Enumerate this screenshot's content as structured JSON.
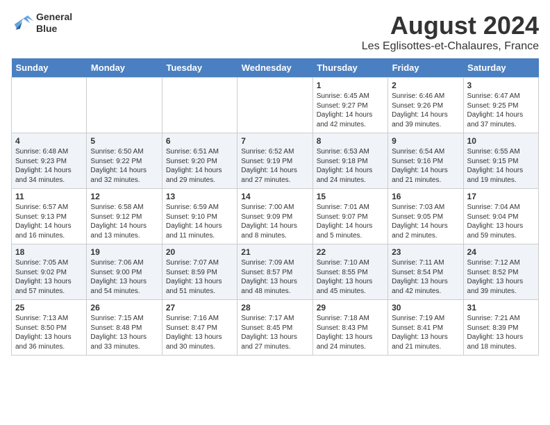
{
  "logo": {
    "line1": "General",
    "line2": "Blue"
  },
  "title": "August 2024",
  "location": "Les Eglisottes-et-Chalaures, France",
  "days_of_week": [
    "Sunday",
    "Monday",
    "Tuesday",
    "Wednesday",
    "Thursday",
    "Friday",
    "Saturday"
  ],
  "weeks": [
    [
      {
        "day": "",
        "content": ""
      },
      {
        "day": "",
        "content": ""
      },
      {
        "day": "",
        "content": ""
      },
      {
        "day": "",
        "content": ""
      },
      {
        "day": "1",
        "content": "Sunrise: 6:45 AM\nSunset: 9:27 PM\nDaylight: 14 hours\nand 42 minutes."
      },
      {
        "day": "2",
        "content": "Sunrise: 6:46 AM\nSunset: 9:26 PM\nDaylight: 14 hours\nand 39 minutes."
      },
      {
        "day": "3",
        "content": "Sunrise: 6:47 AM\nSunset: 9:25 PM\nDaylight: 14 hours\nand 37 minutes."
      }
    ],
    [
      {
        "day": "4",
        "content": "Sunrise: 6:48 AM\nSunset: 9:23 PM\nDaylight: 14 hours\nand 34 minutes."
      },
      {
        "day": "5",
        "content": "Sunrise: 6:50 AM\nSunset: 9:22 PM\nDaylight: 14 hours\nand 32 minutes."
      },
      {
        "day": "6",
        "content": "Sunrise: 6:51 AM\nSunset: 9:20 PM\nDaylight: 14 hours\nand 29 minutes."
      },
      {
        "day": "7",
        "content": "Sunrise: 6:52 AM\nSunset: 9:19 PM\nDaylight: 14 hours\nand 27 minutes."
      },
      {
        "day": "8",
        "content": "Sunrise: 6:53 AM\nSunset: 9:18 PM\nDaylight: 14 hours\nand 24 minutes."
      },
      {
        "day": "9",
        "content": "Sunrise: 6:54 AM\nSunset: 9:16 PM\nDaylight: 14 hours\nand 21 minutes."
      },
      {
        "day": "10",
        "content": "Sunrise: 6:55 AM\nSunset: 9:15 PM\nDaylight: 14 hours\nand 19 minutes."
      }
    ],
    [
      {
        "day": "11",
        "content": "Sunrise: 6:57 AM\nSunset: 9:13 PM\nDaylight: 14 hours\nand 16 minutes."
      },
      {
        "day": "12",
        "content": "Sunrise: 6:58 AM\nSunset: 9:12 PM\nDaylight: 14 hours\nand 13 minutes."
      },
      {
        "day": "13",
        "content": "Sunrise: 6:59 AM\nSunset: 9:10 PM\nDaylight: 14 hours\nand 11 minutes."
      },
      {
        "day": "14",
        "content": "Sunrise: 7:00 AM\nSunset: 9:09 PM\nDaylight: 14 hours\nand 8 minutes."
      },
      {
        "day": "15",
        "content": "Sunrise: 7:01 AM\nSunset: 9:07 PM\nDaylight: 14 hours\nand 5 minutes."
      },
      {
        "day": "16",
        "content": "Sunrise: 7:03 AM\nSunset: 9:05 PM\nDaylight: 14 hours\nand 2 minutes."
      },
      {
        "day": "17",
        "content": "Sunrise: 7:04 AM\nSunset: 9:04 PM\nDaylight: 13 hours\nand 59 minutes."
      }
    ],
    [
      {
        "day": "18",
        "content": "Sunrise: 7:05 AM\nSunset: 9:02 PM\nDaylight: 13 hours\nand 57 minutes."
      },
      {
        "day": "19",
        "content": "Sunrise: 7:06 AM\nSunset: 9:00 PM\nDaylight: 13 hours\nand 54 minutes."
      },
      {
        "day": "20",
        "content": "Sunrise: 7:07 AM\nSunset: 8:59 PM\nDaylight: 13 hours\nand 51 minutes."
      },
      {
        "day": "21",
        "content": "Sunrise: 7:09 AM\nSunset: 8:57 PM\nDaylight: 13 hours\nand 48 minutes."
      },
      {
        "day": "22",
        "content": "Sunrise: 7:10 AM\nSunset: 8:55 PM\nDaylight: 13 hours\nand 45 minutes."
      },
      {
        "day": "23",
        "content": "Sunrise: 7:11 AM\nSunset: 8:54 PM\nDaylight: 13 hours\nand 42 minutes."
      },
      {
        "day": "24",
        "content": "Sunrise: 7:12 AM\nSunset: 8:52 PM\nDaylight: 13 hours\nand 39 minutes."
      }
    ],
    [
      {
        "day": "25",
        "content": "Sunrise: 7:13 AM\nSunset: 8:50 PM\nDaylight: 13 hours\nand 36 minutes."
      },
      {
        "day": "26",
        "content": "Sunrise: 7:15 AM\nSunset: 8:48 PM\nDaylight: 13 hours\nand 33 minutes."
      },
      {
        "day": "27",
        "content": "Sunrise: 7:16 AM\nSunset: 8:47 PM\nDaylight: 13 hours\nand 30 minutes."
      },
      {
        "day": "28",
        "content": "Sunrise: 7:17 AM\nSunset: 8:45 PM\nDaylight: 13 hours\nand 27 minutes."
      },
      {
        "day": "29",
        "content": "Sunrise: 7:18 AM\nSunset: 8:43 PM\nDaylight: 13 hours\nand 24 minutes."
      },
      {
        "day": "30",
        "content": "Sunrise: 7:19 AM\nSunset: 8:41 PM\nDaylight: 13 hours\nand 21 minutes."
      },
      {
        "day": "31",
        "content": "Sunrise: 7:21 AM\nSunset: 8:39 PM\nDaylight: 13 hours\nand 18 minutes."
      }
    ]
  ]
}
